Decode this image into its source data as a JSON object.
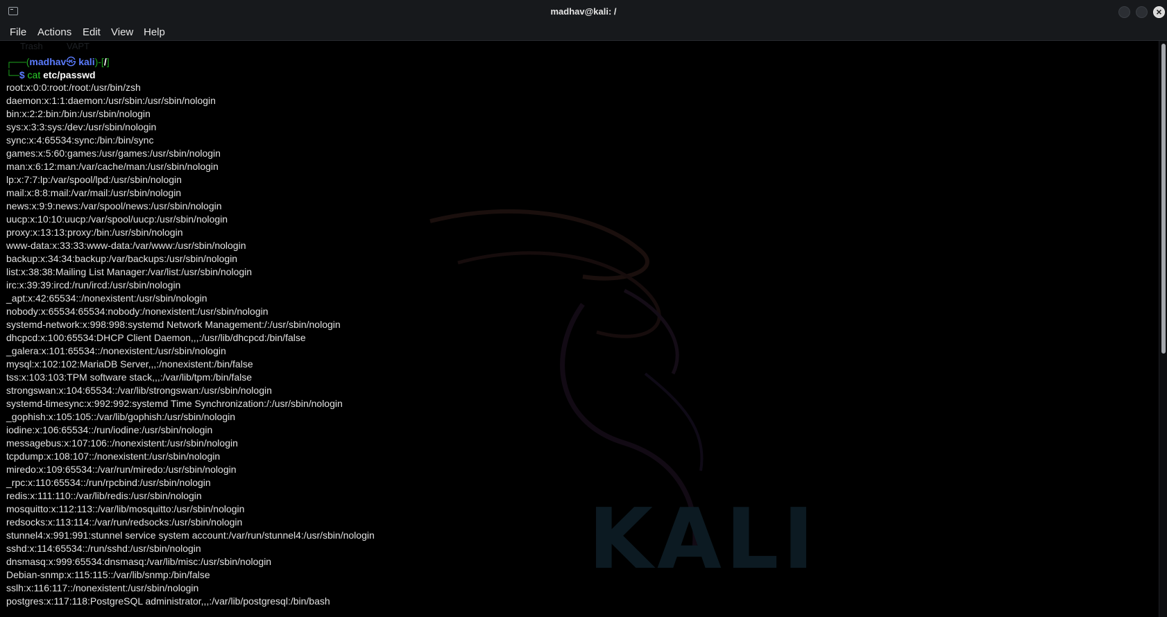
{
  "window": {
    "title": "madhav@kali: /",
    "close_glyph": "×"
  },
  "menu": [
    "File",
    "Actions",
    "Edit",
    "View",
    "Help"
  ],
  "background_ghost": {
    "trash": "Trash",
    "vapt": "VAPT",
    "logo_word": "KALI"
  },
  "prompt": {
    "box_top": "┌──(",
    "user": "madhav",
    "skull_icon": "㉿",
    "host": "kali",
    "mid": ")-[",
    "path": "/",
    "end": "]",
    "box_bottom": "└─",
    "dollar": "$ ",
    "command": "cat",
    "argument": " etc/passwd"
  },
  "output_lines": [
    "root:x:0:0:root:/root:/usr/bin/zsh",
    "daemon:x:1:1:daemon:/usr/sbin:/usr/sbin/nologin",
    "bin:x:2:2:bin:/bin:/usr/sbin/nologin",
    "sys:x:3:3:sys:/dev:/usr/sbin/nologin",
    "sync:x:4:65534:sync:/bin:/bin/sync",
    "games:x:5:60:games:/usr/games:/usr/sbin/nologin",
    "man:x:6:12:man:/var/cache/man:/usr/sbin/nologin",
    "lp:x:7:7:lp:/var/spool/lpd:/usr/sbin/nologin",
    "mail:x:8:8:mail:/var/mail:/usr/sbin/nologin",
    "news:x:9:9:news:/var/spool/news:/usr/sbin/nologin",
    "uucp:x:10:10:uucp:/var/spool/uucp:/usr/sbin/nologin",
    "proxy:x:13:13:proxy:/bin:/usr/sbin/nologin",
    "www-data:x:33:33:www-data:/var/www:/usr/sbin/nologin",
    "backup:x:34:34:backup:/var/backups:/usr/sbin/nologin",
    "list:x:38:38:Mailing List Manager:/var/list:/usr/sbin/nologin",
    "irc:x:39:39:ircd:/run/ircd:/usr/sbin/nologin",
    "_apt:x:42:65534::/nonexistent:/usr/sbin/nologin",
    "nobody:x:65534:65534:nobody:/nonexistent:/usr/sbin/nologin",
    "systemd-network:x:998:998:systemd Network Management:/:/usr/sbin/nologin",
    "dhcpcd:x:100:65534:DHCP Client Daemon,,,:/usr/lib/dhcpcd:/bin/false",
    "_galera:x:101:65534::/nonexistent:/usr/sbin/nologin",
    "mysql:x:102:102:MariaDB Server,,,:/nonexistent:/bin/false",
    "tss:x:103:103:TPM software stack,,,:/var/lib/tpm:/bin/false",
    "strongswan:x:104:65534::/var/lib/strongswan:/usr/sbin/nologin",
    "systemd-timesync:x:992:992:systemd Time Synchronization:/:/usr/sbin/nologin",
    "_gophish:x:105:105::/var/lib/gophish:/usr/sbin/nologin",
    "iodine:x:106:65534::/run/iodine:/usr/sbin/nologin",
    "messagebus:x:107:106::/nonexistent:/usr/sbin/nologin",
    "tcpdump:x:108:107::/nonexistent:/usr/sbin/nologin",
    "miredo:x:109:65534::/var/run/miredo:/usr/sbin/nologin",
    "_rpc:x:110:65534::/run/rpcbind:/usr/sbin/nologin",
    "redis:x:111:110::/var/lib/redis:/usr/sbin/nologin",
    "mosquitto:x:112:113::/var/lib/mosquitto:/usr/sbin/nologin",
    "redsocks:x:113:114::/var/run/redsocks:/usr/sbin/nologin",
    "stunnel4:x:991:991:stunnel service system account:/var/run/stunnel4:/usr/sbin/nologin",
    "sshd:x:114:65534::/run/sshd:/usr/sbin/nologin",
    "dnsmasq:x:999:65534:dnsmasq:/var/lib/misc:/usr/sbin/nologin",
    "Debian-snmp:x:115:115::/var/lib/snmp:/bin/false",
    "sslh:x:116:117::/nonexistent:/usr/sbin/nologin",
    "postgres:x:117:118:PostgreSQL administrator,,,:/var/lib/postgresql:/bin/bash"
  ],
  "colors": {
    "prompt_box": "#1fa51f",
    "prompt_user": "#5b7cff",
    "command": "#2ad12a",
    "text": "#e2e2e2",
    "background": "#000000"
  }
}
